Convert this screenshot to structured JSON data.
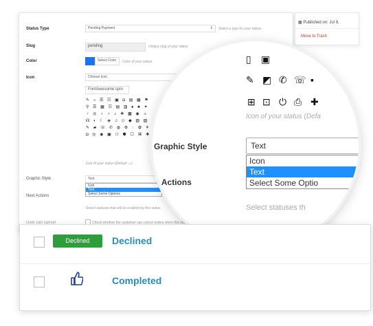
{
  "admin": {
    "status_type_label": "Status Type",
    "status_type_value": "Pending Payment",
    "status_type_hint": "Select a type for your status.",
    "slug_label": "Slug",
    "slug_value": "pending",
    "slug_hint": "Unique slug of your status",
    "color_label": "Color",
    "color_button": "Select Color",
    "color_hint": "Color of your status",
    "color_value": "#1e73ec",
    "icon_label": "Icon",
    "icon_select": "Choose Icon",
    "icon_value": "FontAwesome:spin",
    "icon_hint": "Icon of your status (Default ☺)",
    "graphic_style_label": "Graphic Style",
    "graphic_style_value": "Text",
    "graphic_style_options": [
      "Icon",
      "Text",
      "Select Some Options"
    ],
    "next_actions_label": "Next Actions",
    "next_actions_hint": "Select statuses that will be enabled by this status",
    "user_cancel_label": "User can cancel",
    "user_cancel_hint": "Check whether the customer can cancel orders when this status is active"
  },
  "sidebox": {
    "published": "Published on: Jul 9,",
    "trash": "Move to Trash"
  },
  "lens": {
    "graphic_style_label": "Graphic Style",
    "next_actions_label": "t Actions",
    "icon_hint": "Icon of your status (Defa",
    "select_value": "Text",
    "options": [
      "Icon",
      "Text",
      "Select Some Optio"
    ],
    "statuses_hint": "Select statuses th"
  },
  "rows": [
    {
      "badge": "Declined",
      "name": "Declined"
    },
    {
      "badge": "",
      "name": "Completed"
    }
  ],
  "colors": {
    "accent": "#2a8bb5",
    "badge_green": "#2e9e3c",
    "selected_blue": "#1e90ff",
    "thumb": "#1a3fa0"
  }
}
